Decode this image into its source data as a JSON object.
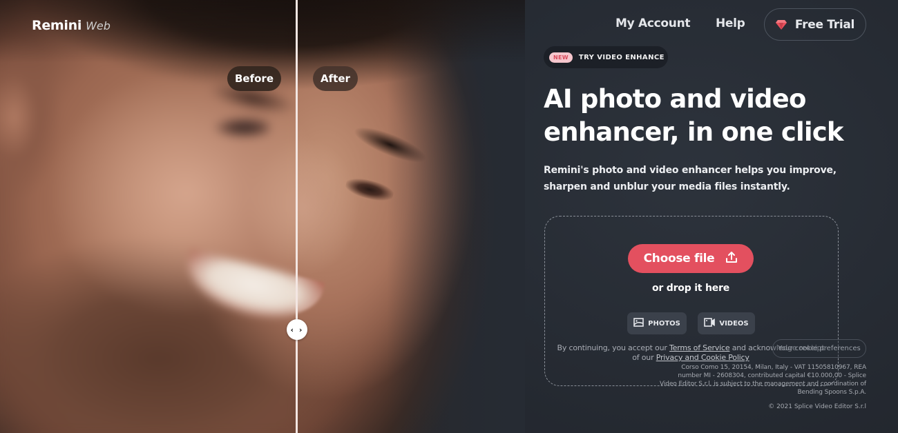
{
  "header": {
    "logo_brand": "Remini",
    "logo_sub": "Web",
    "nav": {
      "my_account": "My Account",
      "help": "Help",
      "free_trial": "Free Trial"
    }
  },
  "comparison": {
    "before_label": "Before",
    "after_label": "After",
    "handle_glyph": "‹ ›",
    "slider_position_percent": 33
  },
  "hero": {
    "badge_new": "NEW",
    "badge_label": "TRY VIDEO ENHANCE",
    "headline": "AI photo and video enhancer, in one click",
    "subtext": "Remini's photo and video enhancer helps you improve, sharpen and unblur your media files instantly."
  },
  "upload": {
    "choose_file_label": "Choose file",
    "drop_text": "or drop it here",
    "photos_label": "PHOTOS",
    "videos_label": "VIDEOS"
  },
  "legal": {
    "prefix": "By continuing, you accept our ",
    "terms_link": "Terms of Service",
    "middle": " and acknowledge receipt of our ",
    "privacy_link": "Privacy and Cookie Policy"
  },
  "cookie_button": "Your cookie preferences",
  "footer": {
    "company_info": "Corso Como 15, 20154, Milan, Italy - VAT 11505810967, REA number MI - 2608304, contributed capital €10.000,00 - Splice Video Editor S.r.l. is subject to the management and coordination of Bending Spoons S.p.A.",
    "copyright": "© 2021 Splice Video Editor S.r.l"
  },
  "icons": {
    "gem": "gem-icon",
    "upload": "upload-icon",
    "photo": "image-icon",
    "video": "video-camera-icon",
    "slider": "chevrons-left-right-icon"
  },
  "colors": {
    "accent": "#e3505f",
    "background": "#262b33",
    "badge_new_bg": "#f6c6cd",
    "badge_new_text": "#d94a5c"
  }
}
